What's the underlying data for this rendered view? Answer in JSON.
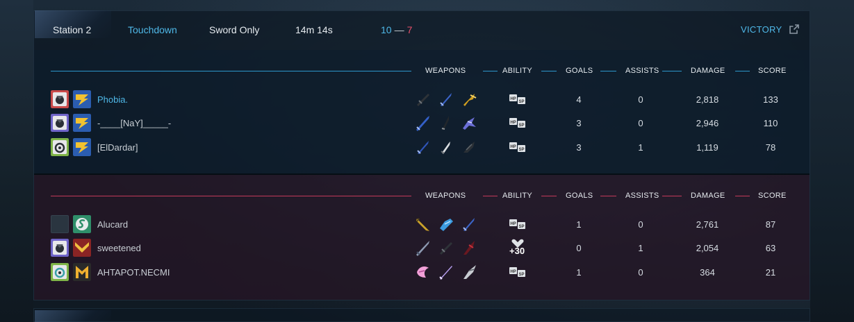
{
  "match": {
    "map": "Station 2",
    "mode": "Touchdown",
    "variant": "Sword Only",
    "duration": "14m 14s",
    "score_blue": "10",
    "score_sep": "—",
    "score_red": "7",
    "result": "VICTORY"
  },
  "columns": {
    "weapons": "WEAPONS",
    "ability": "ABILITY",
    "goals": "GOALS",
    "assists": "ASSISTS",
    "damage": "DAMAGE",
    "score": "SCORE"
  },
  "colors": {
    "blue_accent": "#4fb8e8",
    "red_accent": "#e8506a"
  },
  "blue_team": {
    "players": [
      {
        "name": "Phobia.",
        "ability": "hp-sp-icon",
        "goals": "4",
        "assists": "0",
        "damage": "2,818",
        "score": "133"
      },
      {
        "name": "-____[NaY]_____-",
        "ability": "hp-sp-icon",
        "goals": "3",
        "assists": "0",
        "damage": "2,946",
        "score": "110"
      },
      {
        "name": "[ElDardar]",
        "ability": "hp-sp-icon",
        "goals": "3",
        "assists": "1",
        "damage": "1,119",
        "score": "78"
      }
    ]
  },
  "red_team": {
    "players": [
      {
        "name": "Alucard",
        "ability": "hp-sp-icon",
        "goals": "1",
        "assists": "0",
        "damage": "2,761",
        "score": "87"
      },
      {
        "name": "sweetened",
        "ability_text": "+30",
        "goals": "0",
        "assists": "1",
        "damage": "2,054",
        "score": "63"
      },
      {
        "name": "AHTAPOT.NECMI",
        "ability": "hp-sp-icon",
        "goals": "1",
        "assists": "0",
        "damage": "364",
        "score": "21"
      }
    ]
  }
}
